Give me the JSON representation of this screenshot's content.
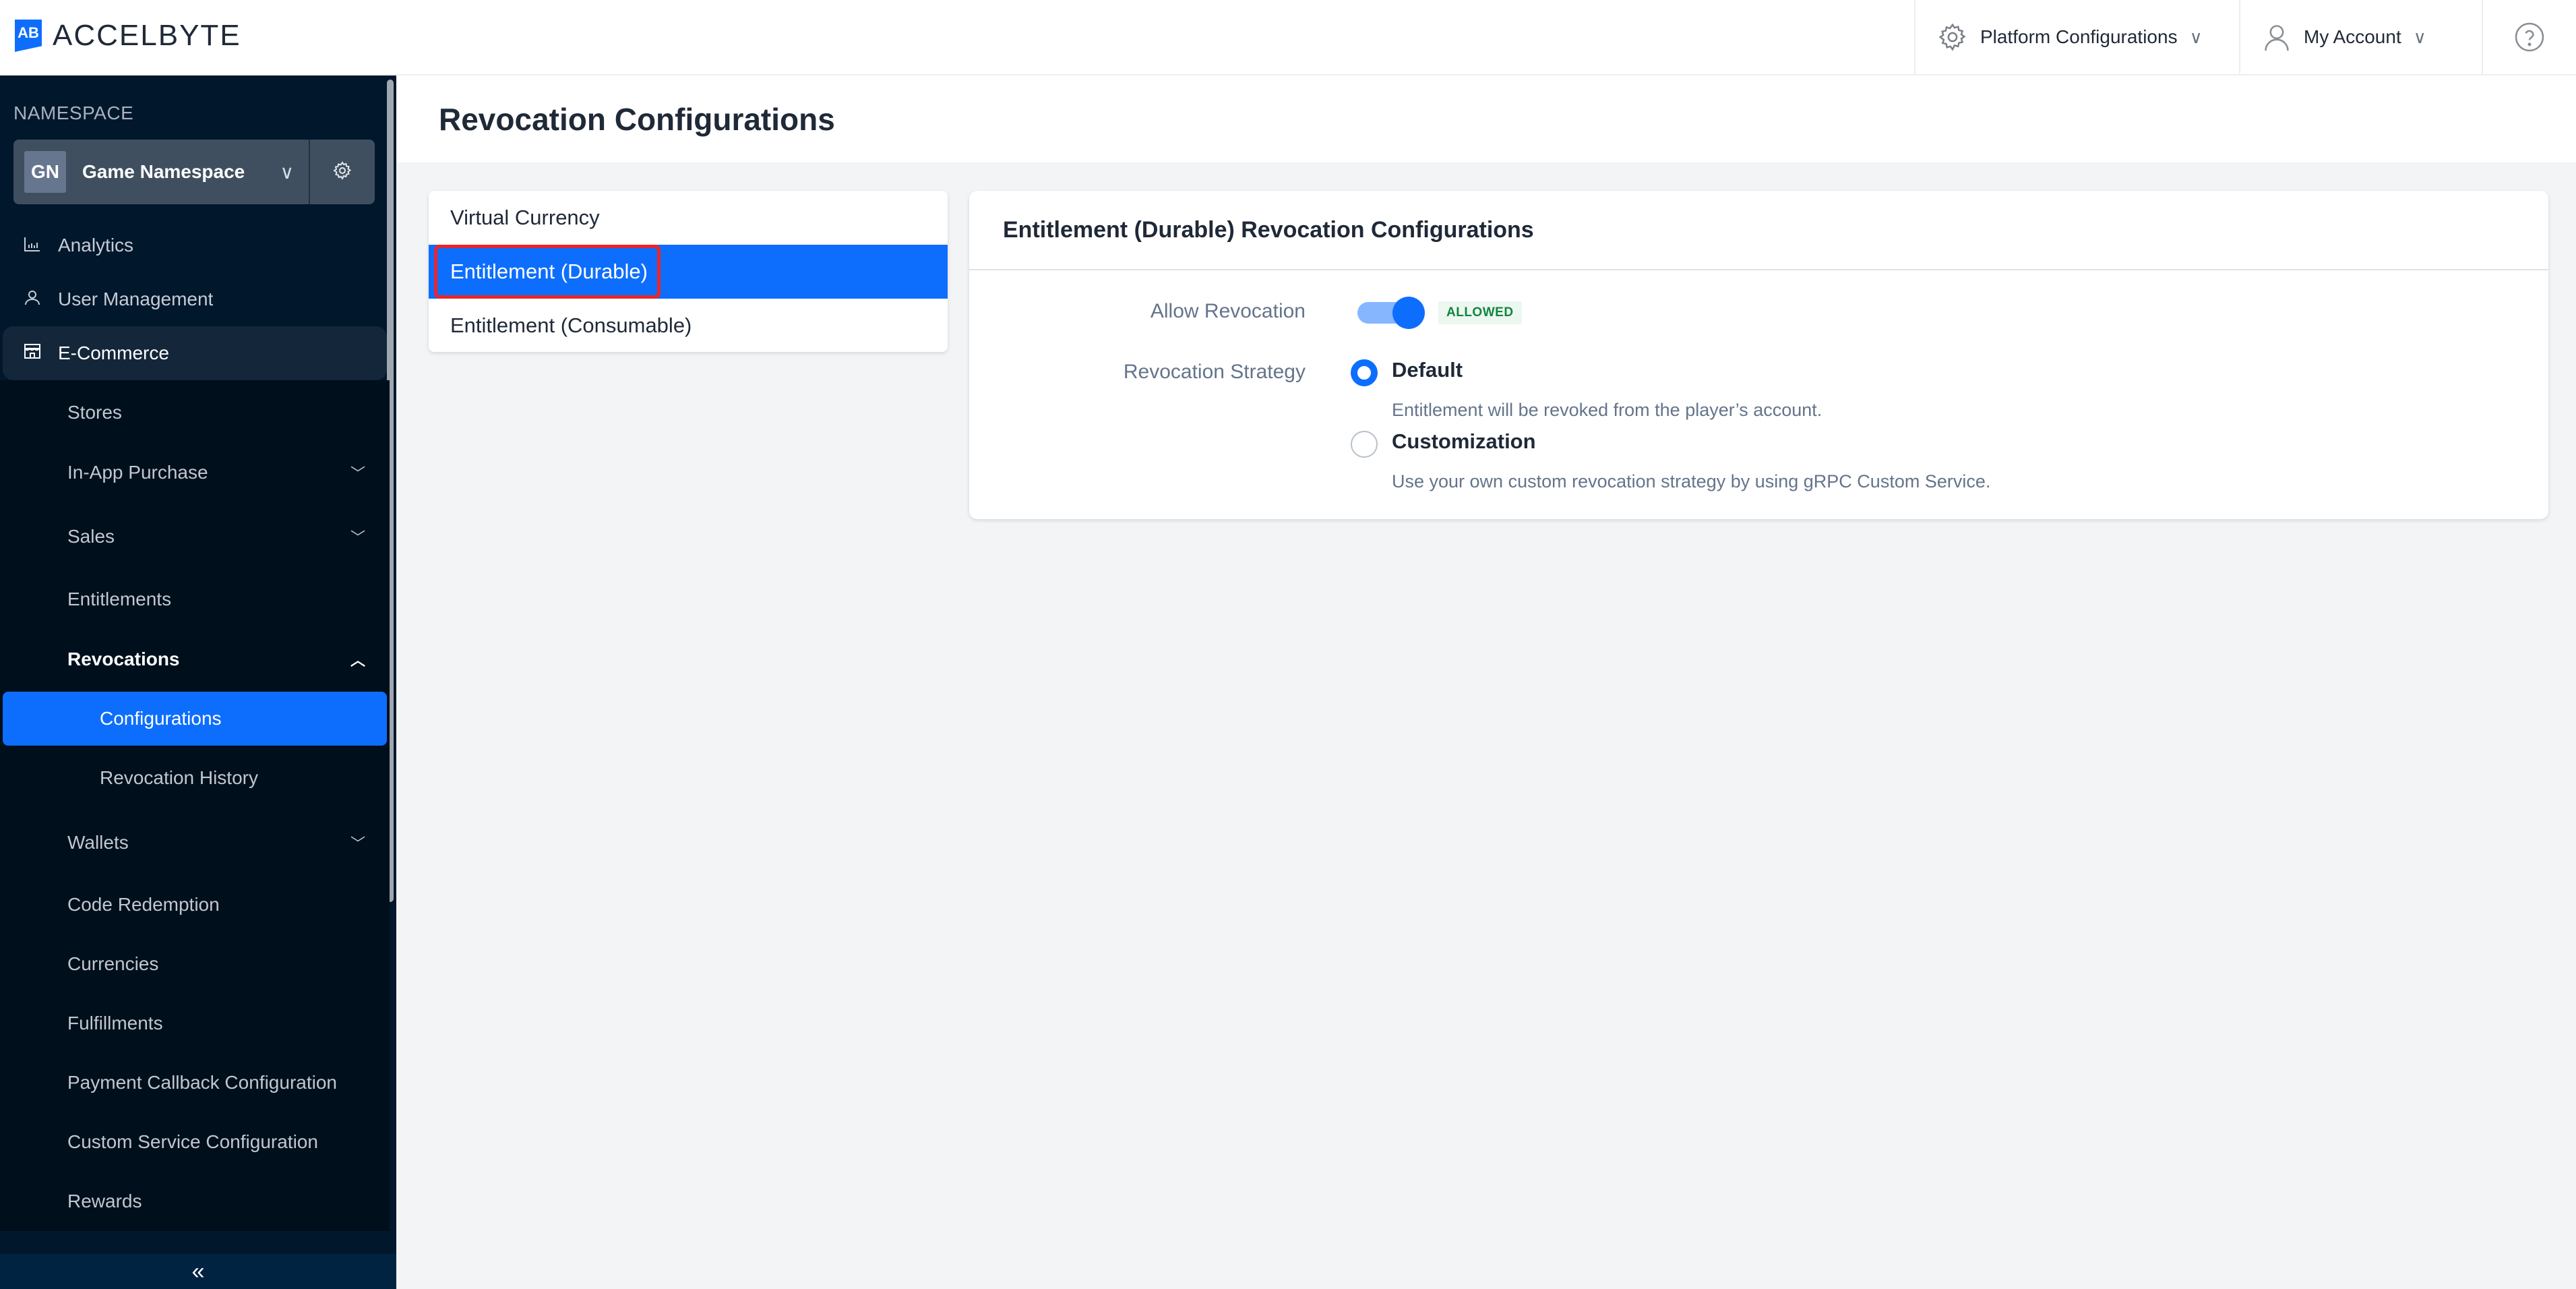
{
  "header": {
    "brand": "ACCELBYTE",
    "brand_mark": "AB",
    "platform_configurations": "Platform Configurations",
    "my_account": "My Account"
  },
  "sidebar": {
    "namespace_label": "NAMESPACE",
    "namespace_initials": "GN",
    "namespace_name": "Game Namespace",
    "top_items": [
      {
        "label": "Analytics",
        "icon": "chart-icon"
      },
      {
        "label": "User Management",
        "icon": "user-icon"
      },
      {
        "label": "E-Commerce",
        "icon": "store-icon"
      }
    ],
    "ecommerce_items": [
      {
        "label": "Stores",
        "expandable": false
      },
      {
        "label": "In-App Purchase",
        "expandable": true
      },
      {
        "label": "Sales",
        "expandable": true
      },
      {
        "label": "Entitlements",
        "expandable": false
      },
      {
        "label": "Revocations",
        "expandable": true,
        "expanded": true
      }
    ],
    "revocation_items": [
      {
        "label": "Configurations",
        "selected": true
      },
      {
        "label": "Revocation History",
        "selected": false
      }
    ],
    "more_items": [
      {
        "label": "Wallets",
        "expandable": true
      },
      {
        "label": "Code Redemption",
        "expandable": false
      },
      {
        "label": "Currencies",
        "expandable": false
      },
      {
        "label": "Fulfillments",
        "expandable": false
      },
      {
        "label": "Payment Callback Configuration",
        "expandable": false
      },
      {
        "label": "Custom Service Configuration",
        "expandable": false
      },
      {
        "label": "Rewards",
        "expandable": false
      }
    ],
    "collapse_glyph": "«"
  },
  "page": {
    "title": "Revocation Configurations"
  },
  "config_types": [
    {
      "label": "Virtual Currency",
      "selected": false
    },
    {
      "label": "Entitlement (Durable)",
      "selected": true
    },
    {
      "label": "Entitlement (Consumable)",
      "selected": false
    }
  ],
  "config_panel": {
    "title": "Entitlement (Durable) Revocation Configurations",
    "allow_revocation_label": "Allow Revocation",
    "allow_revocation_enabled": true,
    "allow_revocation_badge": "ALLOWED",
    "strategy_label": "Revocation Strategy",
    "strategies": [
      {
        "title": "Default",
        "description": "Entitlement will be revoked from the player’s account.",
        "selected": true
      },
      {
        "title": "Customization",
        "description": "Use your own custom revocation strategy by using gRPC Custom Service.",
        "selected": false
      }
    ]
  },
  "colors": {
    "accent": "#0d6efd",
    "sidebar_bg": "#01172c",
    "highlight_outline": "#e8262a",
    "badge_text": "#10853f"
  }
}
